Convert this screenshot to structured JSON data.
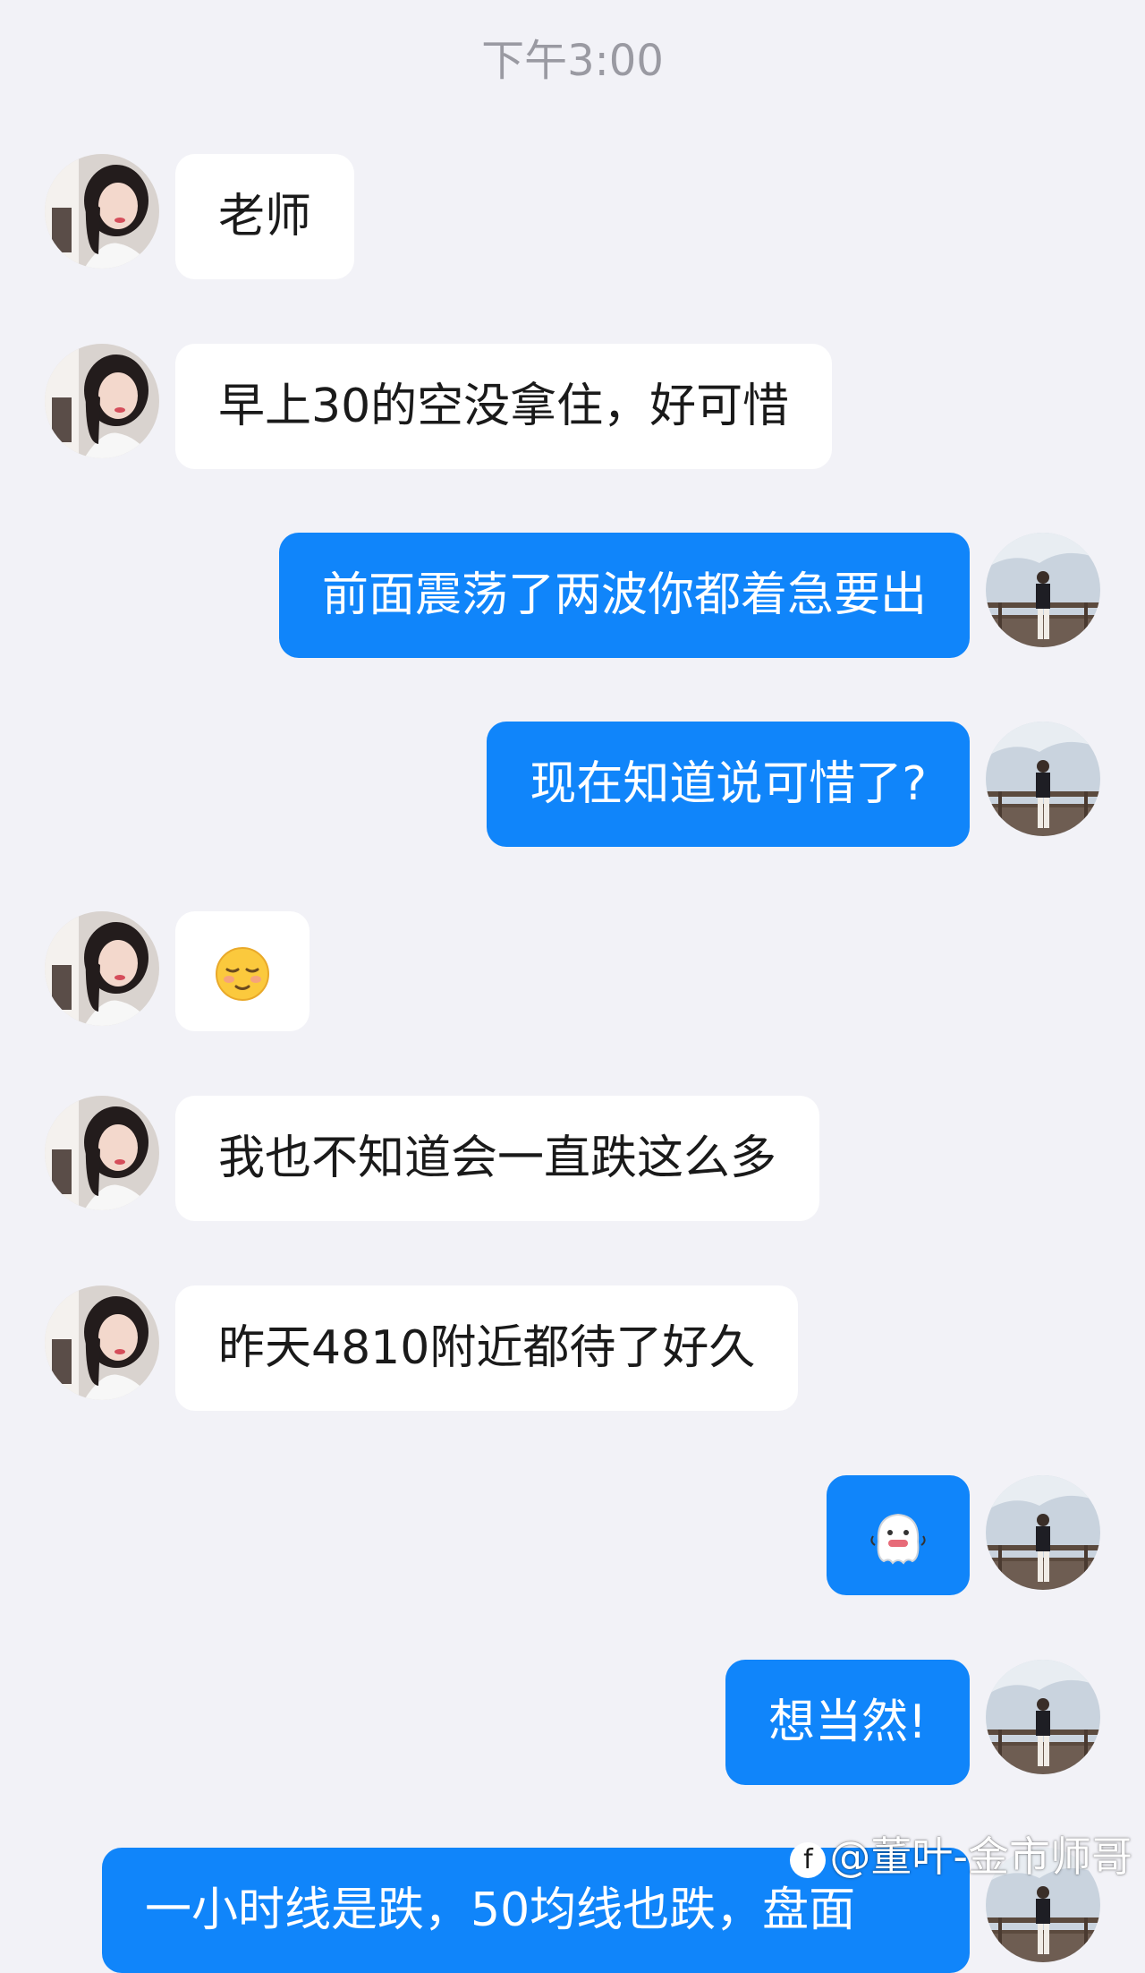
{
  "chat": {
    "timestamp": "下午3:00",
    "messages": [
      {
        "sender": "student",
        "text": "老师"
      },
      {
        "sender": "student",
        "text": "早上30的空没拿住，好可惜"
      },
      {
        "sender": "teacher",
        "text": "前面震荡了两波你都着急要出"
      },
      {
        "sender": "teacher",
        "text": "现在知道说可惜了?"
      },
      {
        "sender": "student",
        "text": "😌"
      },
      {
        "sender": "student",
        "text": "我也不知道会一直跌这么多"
      },
      {
        "sender": "student",
        "text": "昨天4810附近都待了好久"
      },
      {
        "sender": "teacher",
        "sticker": "ghost-sticker-icon"
      },
      {
        "sender": "teacher",
        "text": "想当然!"
      },
      {
        "sender": "teacher",
        "text": "一小时线是跌，50均线也跌，盘面"
      }
    ]
  },
  "watermark": {
    "logo": "f",
    "text": "@董叶-金市师哥"
  },
  "colors": {
    "background": "#f2f2f7",
    "incoming_bubble": "#ffffff",
    "outgoing_bubble": "#1085fa",
    "timestamp": "#9a9aa2"
  }
}
